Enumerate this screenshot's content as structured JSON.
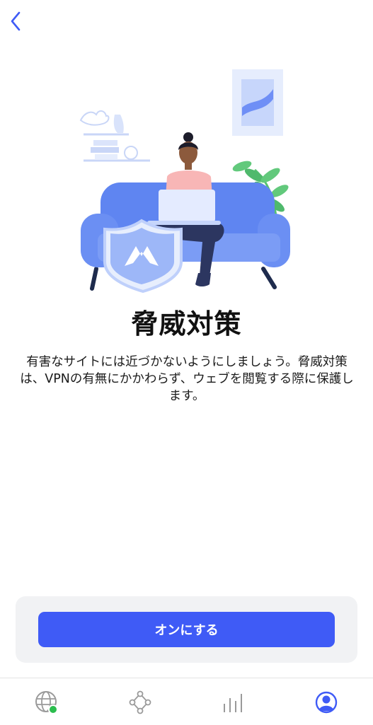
{
  "header": {
    "back_icon": "chevron-left-icon"
  },
  "content": {
    "title": "脅威対策",
    "description": "有害なサイトには近づかないようにしましょう。脅威対策は、VPNの有無にかかわらず、ウェブを閲覧する際に保護します。"
  },
  "action": {
    "button_label": "オンにする"
  },
  "tab_bar": {
    "tabs": [
      {
        "icon": "globe-icon",
        "status": "connected"
      },
      {
        "icon": "meshnet-icon"
      },
      {
        "icon": "stats-icon"
      },
      {
        "icon": "profile-icon",
        "active": true
      }
    ]
  },
  "colors": {
    "accent": "#3f5bf6",
    "connected_dot": "#2bbd4e",
    "icon_gray": "#9a9a9a"
  }
}
